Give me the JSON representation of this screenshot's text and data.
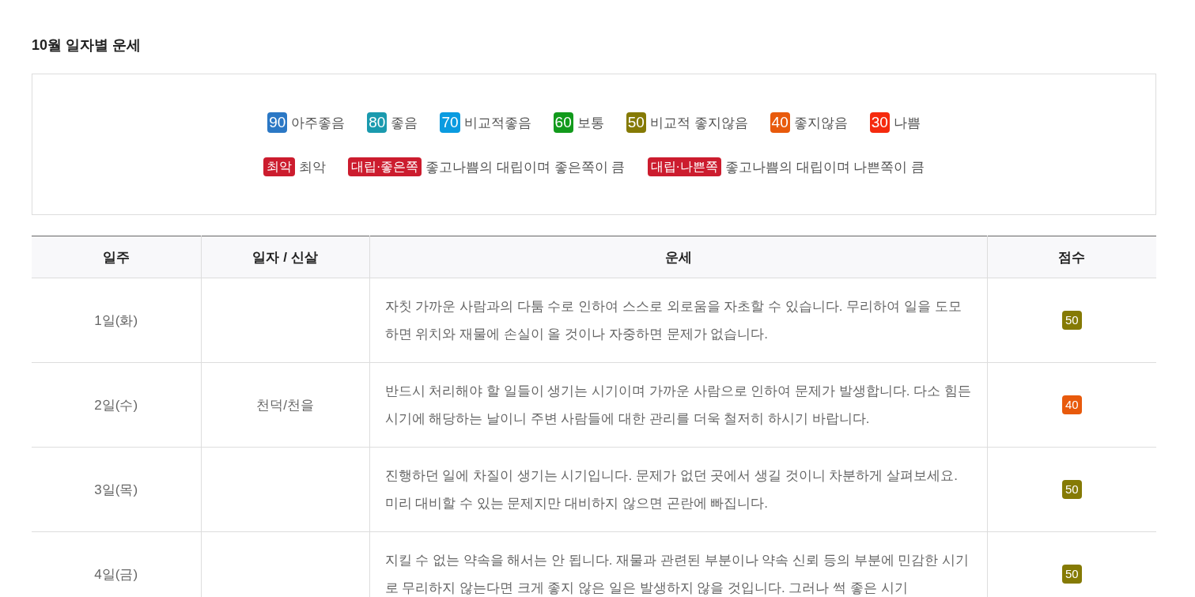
{
  "title": "10월 일자별 운세",
  "legend_scores": [
    {
      "badge": "90",
      "label": "아주좋음",
      "color": "#2b78c5"
    },
    {
      "badge": "80",
      "label": "좋음",
      "color": "#1a9aae"
    },
    {
      "badge": "70",
      "label": "비교적좋음",
      "color": "#0a9be0"
    },
    {
      "badge": "60",
      "label": "보통",
      "color": "#129a1c"
    },
    {
      "badge": "50",
      "label": "비교적 좋지않음",
      "color": "#857a05"
    },
    {
      "badge": "40",
      "label": "좋지않음",
      "color": "#e85a0c"
    },
    {
      "badge": "30",
      "label": "나쁨",
      "color": "#f52a0e"
    }
  ],
  "legend_special": [
    {
      "badge": "최악",
      "label": "최악",
      "color": "#cc1c2e"
    },
    {
      "badge": "대립·좋은쪽",
      "label": "좋고나쁨의 대립이며 좋은쪽이 큼",
      "color": "#cc1c2e"
    },
    {
      "badge": "대립·나쁜쪽",
      "label": "좋고나쁨의 대립이며 나쁜쪽이 큼",
      "color": "#cc1c2e"
    }
  ],
  "table": {
    "columns": [
      "일주",
      "일자 / 신살",
      "운세",
      "점수"
    ],
    "rows": [
      {
        "day": "1일(화)",
        "sinsal": "",
        "fortune": "자칫 가까운 사람과의 다툼 수로 인하여 스스로 외로움을 자초할 수 있습니다. 무리하여 일을 도모하면 위치와 재물에 손실이 올 것이나 자중하면 문제가 없습니다.",
        "score": "50",
        "color": "#857a05"
      },
      {
        "day": "2일(수)",
        "sinsal": "천덕/천을",
        "fortune": "반드시 처리해야 할 일들이 생기는 시기이며 가까운 사람으로 인하여 문제가 발생합니다. 다소 힘든 시기에 해당하는 날이니 주변 사람들에 대한 관리를 더욱 철저히 하시기 바랍니다.",
        "score": "40",
        "color": "#e85a0c"
      },
      {
        "day": "3일(목)",
        "sinsal": "",
        "fortune": "진행하던 일에 차질이 생기는 시기입니다. 문제가 없던 곳에서 생길 것이니 차분하게 살펴보세요. 미리 대비할 수 있는 문제지만 대비하지 않으면 곤란에 빠집니다.",
        "score": "50",
        "color": "#857a05"
      },
      {
        "day": "4일(금)",
        "sinsal": "",
        "fortune": "지킬 수 없는 약속을 해서는 안 됩니다. 재물과 관련된 부분이나 약속 신뢰 등의 부분에 민감한 시기로 무리하지 않는다면 크게 좋지 않은 일은 발생하지 않을 것입니다. 그러나 썩 좋은 시기",
        "score": "50",
        "color": "#857a05"
      }
    ]
  }
}
